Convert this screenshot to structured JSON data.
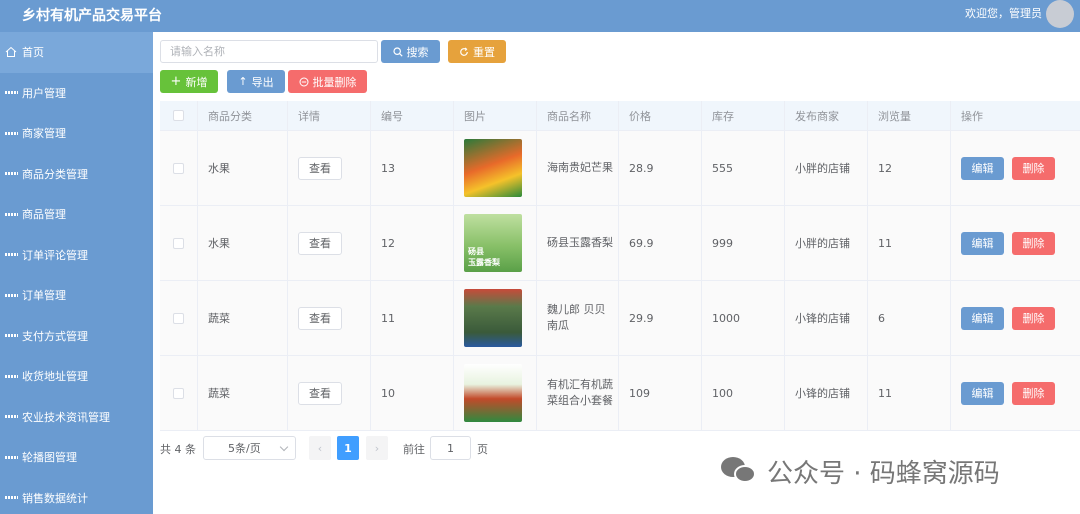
{
  "app": {
    "title": "乡村有机产品交易平台",
    "welcome": "欢迎您，管理员"
  },
  "sidebar": {
    "items": [
      {
        "label": "首页",
        "icon": "home-icon"
      },
      {
        "label": "用户管理",
        "icon": "grid-icon"
      },
      {
        "label": "商家管理",
        "icon": "grid-icon"
      },
      {
        "label": "商品分类管理",
        "icon": "grid-icon"
      },
      {
        "label": "商品管理",
        "icon": "grid-icon"
      },
      {
        "label": "订单评论管理",
        "icon": "grid-icon"
      },
      {
        "label": "订单管理",
        "icon": "grid-icon"
      },
      {
        "label": "支付方式管理",
        "icon": "grid-icon"
      },
      {
        "label": "收货地址管理",
        "icon": "grid-icon"
      },
      {
        "label": "农业技术资讯管理",
        "icon": "grid-icon"
      },
      {
        "label": "轮播图管理",
        "icon": "grid-icon"
      },
      {
        "label": "销售数据统计",
        "icon": "grid-icon"
      }
    ]
  },
  "toolbar": {
    "search_placeholder": "请输入名称",
    "search_label": "搜索",
    "reset_label": "重置",
    "add_label": "新增",
    "export_label": "导出",
    "batch_delete_label": "批量删除"
  },
  "table": {
    "headers": [
      "商品分类",
      "详情",
      "编号",
      "图片",
      "商品名称",
      "价格",
      "库存",
      "发布商家",
      "浏览量",
      "操作"
    ],
    "view_label": "查看",
    "edit_label": "编辑",
    "delete_label": "删除",
    "rows": [
      {
        "category": "水果",
        "id": "13",
        "name": "海南贵妃芒果",
        "price": "28.9",
        "stock": "555",
        "shop": "小胖的店铺",
        "views": "12",
        "image": "mango-product-image"
      },
      {
        "category": "水果",
        "id": "12",
        "name": "砀县玉露香梨",
        "price": "69.9",
        "stock": "999",
        "shop": "小胖的店铺",
        "views": "11",
        "image": "pear-product-image",
        "image_text": [
          "砀县",
          "玉露香梨"
        ]
      },
      {
        "category": "蔬菜",
        "id": "11",
        "name": "魏儿郎 贝贝南瓜",
        "price": "29.9",
        "stock": "1000",
        "shop": "小锋的店铺",
        "views": "6",
        "image": "pumpkin-product-image"
      },
      {
        "category": "蔬菜",
        "id": "10",
        "name": "有机汇有机蔬菜组合小套餐",
        "price": "109",
        "stock": "100",
        "shop": "小锋的店铺",
        "views": "11",
        "image": "vegetable-set-product-image"
      }
    ]
  },
  "pagination": {
    "total_text": "共 4 条",
    "page_size_text": "5条/页",
    "current_page": "1",
    "goto_label": "前往",
    "goto_value": "1",
    "page_unit": "页"
  },
  "watermark": {
    "text": "公众号 · 码蜂窝源码"
  }
}
